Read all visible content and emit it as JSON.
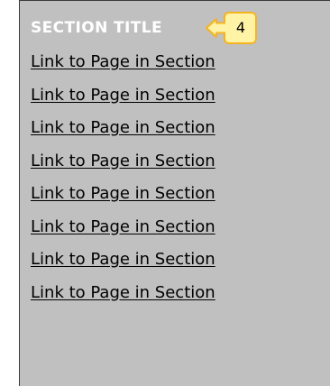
{
  "section": {
    "title": "SECTION TITLE",
    "badge_count": "4",
    "links": [
      "Link to Page in Section",
      "Link to Page in Section",
      "Link to Page in Section",
      "Link to Page in Section",
      "Link to Page in Section",
      "Link to Page in Section",
      "Link to Page in Section",
      "Link to Page in Section"
    ]
  },
  "colors": {
    "panel_background": "#c0c0c0",
    "title_text": "#ffffff",
    "badge_fill": "#fff3a6",
    "badge_border": "#f5b321",
    "link_text": "#000000"
  }
}
